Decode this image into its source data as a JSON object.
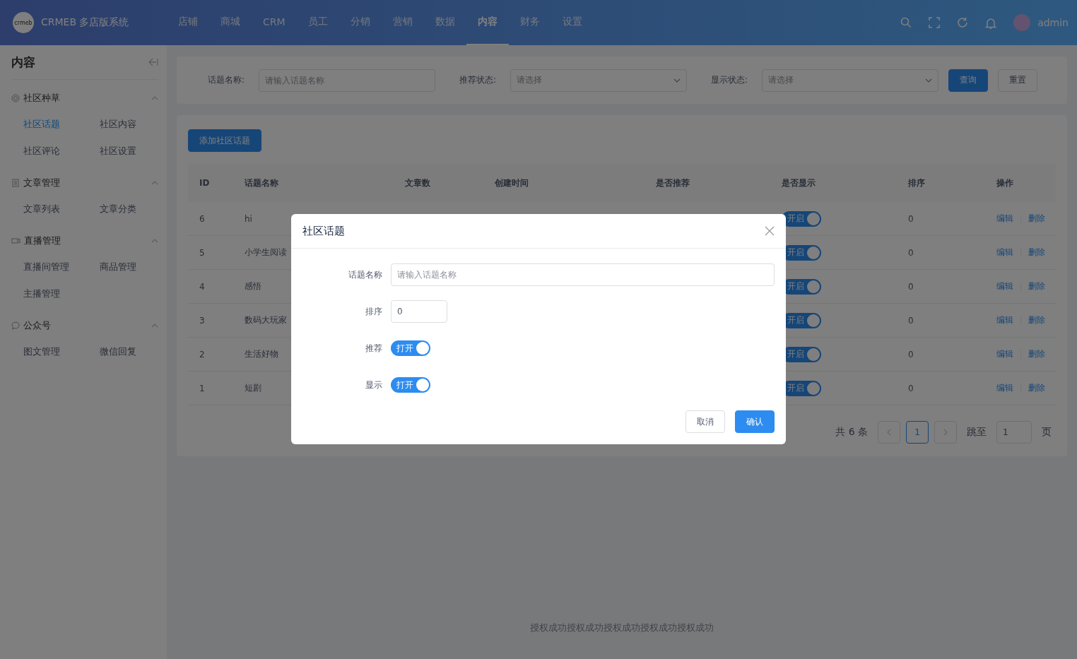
{
  "header": {
    "logo_text": "crmeb",
    "title": "CRMEB 多店版系统",
    "nav": [
      {
        "label": "店铺",
        "selected": false
      },
      {
        "label": "商城",
        "selected": false
      },
      {
        "label": "CRM",
        "selected": false
      },
      {
        "label": "员工",
        "selected": false
      },
      {
        "label": "分销",
        "selected": false
      },
      {
        "label": "营销",
        "selected": false
      },
      {
        "label": "数据",
        "selected": false
      },
      {
        "label": "内容",
        "selected": true
      },
      {
        "label": "财务",
        "selected": false
      },
      {
        "label": "设置",
        "selected": false
      }
    ],
    "user": "admin"
  },
  "sidebar": {
    "title": "内容",
    "groups": [
      {
        "kind": "target",
        "label": "社区种草",
        "expanded": true,
        "items": [
          {
            "label": "社区话题",
            "selected": true
          },
          {
            "label": "社区内容",
            "selected": false
          },
          {
            "label": "社区评论",
            "selected": false
          },
          {
            "label": "社区设置",
            "selected": false
          }
        ]
      },
      {
        "kind": "doc",
        "label": "文章管理",
        "expanded": true,
        "items": [
          {
            "label": "文章列表",
            "selected": false
          },
          {
            "label": "文章分类",
            "selected": false
          }
        ]
      },
      {
        "kind": "video",
        "label": "直播管理",
        "expanded": true,
        "items": [
          {
            "label": "直播间管理",
            "selected": false
          },
          {
            "label": "商品管理",
            "selected": false
          },
          {
            "label": "主播管理",
            "selected": false
          }
        ]
      },
      {
        "kind": "chat",
        "label": "公众号",
        "expanded": true,
        "items": [
          {
            "label": "图文管理",
            "selected": false
          },
          {
            "label": "微信回复",
            "selected": false
          }
        ]
      }
    ]
  },
  "filters": {
    "fields": [
      {
        "kind": "input",
        "label": "话题名称:",
        "placeholder": "请输入话题名称"
      },
      {
        "kind": "select",
        "label": "推荐状态:",
        "placeholder": "请选择"
      },
      {
        "kind": "select",
        "label": "显示状态:",
        "placeholder": "请选择"
      }
    ],
    "search_button": "查询",
    "reset_button": "重置"
  },
  "add_button": "添加社区话题",
  "table": {
    "columns": [
      "ID",
      "话题名称",
      "文章数",
      "创建时间",
      "是否推荐",
      "是否显示",
      "排序",
      "操作"
    ],
    "rows": [
      {
        "id": "6",
        "name": "hi",
        "show": {
          "on": true,
          "label": "开启"
        },
        "sort": "0",
        "actions": [
          "编辑",
          "删除"
        ]
      },
      {
        "id": "5",
        "name": "小学生阅读",
        "show": {
          "on": true,
          "label": "开启"
        },
        "sort": "0",
        "actions": [
          "编辑",
          "删除"
        ]
      },
      {
        "id": "4",
        "name": "感悟",
        "show": {
          "on": true,
          "label": "开启"
        },
        "sort": "0",
        "actions": [
          "编辑",
          "删除"
        ]
      },
      {
        "id": "3",
        "name": "数码大玩家",
        "show": {
          "on": true,
          "label": "开启"
        },
        "sort": "0",
        "actions": [
          "编辑",
          "删除"
        ]
      },
      {
        "id": "2",
        "name": "生活好物",
        "show": {
          "on": true,
          "label": "开启"
        },
        "sort": "0",
        "actions": [
          "编辑",
          "删除"
        ]
      },
      {
        "id": "1",
        "name": "短剧",
        "show": {
          "on": true,
          "label": "开启"
        },
        "sort": "0",
        "actions": [
          "编辑",
          "删除"
        ]
      }
    ]
  },
  "pagination": {
    "total": "共 6 条",
    "pages": [
      {
        "label": "1",
        "selected": true
      }
    ],
    "jump_label": "跳至",
    "jump_value": "1",
    "page_unit": "页"
  },
  "footer": "授权成功授权成功授权成功授权成功授权成功",
  "dialog": {
    "title": "社区话题",
    "fields": [
      {
        "kind": "input",
        "label": "话题名称",
        "placeholder": "请输入话题名称"
      },
      {
        "kind": "number",
        "label": "排序",
        "value": "0"
      },
      {
        "kind": "switch",
        "label": "推荐",
        "on": true,
        "text": "打开"
      },
      {
        "kind": "switch",
        "label": "显示",
        "on": true,
        "text": "打开"
      }
    ],
    "cancel": "取消",
    "confirm": "确认"
  }
}
